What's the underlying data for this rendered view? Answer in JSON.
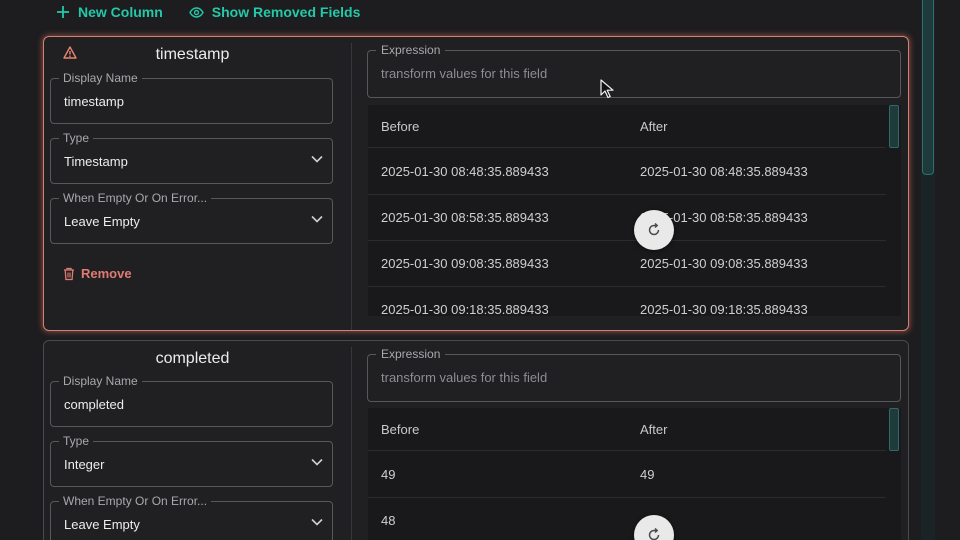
{
  "toolbar": {
    "new_column_label": "New Column",
    "show_removed_label": "Show Removed Fields"
  },
  "colors": {
    "accent": "#23c9a8",
    "danger": "#de7b72",
    "warning": "#e8846f"
  },
  "fields": [
    {
      "name": "timestamp",
      "state": "error",
      "display_name": {
        "label": "Display Name",
        "value": "timestamp"
      },
      "type": {
        "label": "Type",
        "value": "Timestamp"
      },
      "on_empty": {
        "label": "When Empty Or On Error...",
        "value": "Leave Empty"
      },
      "remove_label": "Remove",
      "expression": {
        "label": "Expression",
        "placeholder": "transform values for this field"
      },
      "preview": {
        "columns": [
          "Before",
          "After"
        ],
        "rows": [
          [
            "2025-01-30 08:48:35.889433",
            "2025-01-30 08:48:35.889433"
          ],
          [
            "2025-01-30 08:58:35.889433",
            "2025-01-30 08:58:35.889433"
          ],
          [
            "2025-01-30 09:08:35.889433",
            "2025-01-30 09:08:35.889433"
          ],
          [
            "2025-01-30 09:18:35.889433",
            "2025-01-30 09:18:35.889433"
          ]
        ]
      }
    },
    {
      "name": "completed",
      "state": "normal",
      "display_name": {
        "label": "Display Name",
        "value": "completed"
      },
      "type": {
        "label": "Type",
        "value": "Integer"
      },
      "on_empty": {
        "label": "When Empty Or On Error...",
        "value": "Leave Empty"
      },
      "expression": {
        "label": "Expression",
        "placeholder": "transform values for this field"
      },
      "preview": {
        "columns": [
          "Before",
          "After"
        ],
        "rows": [
          [
            "49",
            "49"
          ],
          [
            "48",
            ""
          ]
        ]
      }
    }
  ]
}
